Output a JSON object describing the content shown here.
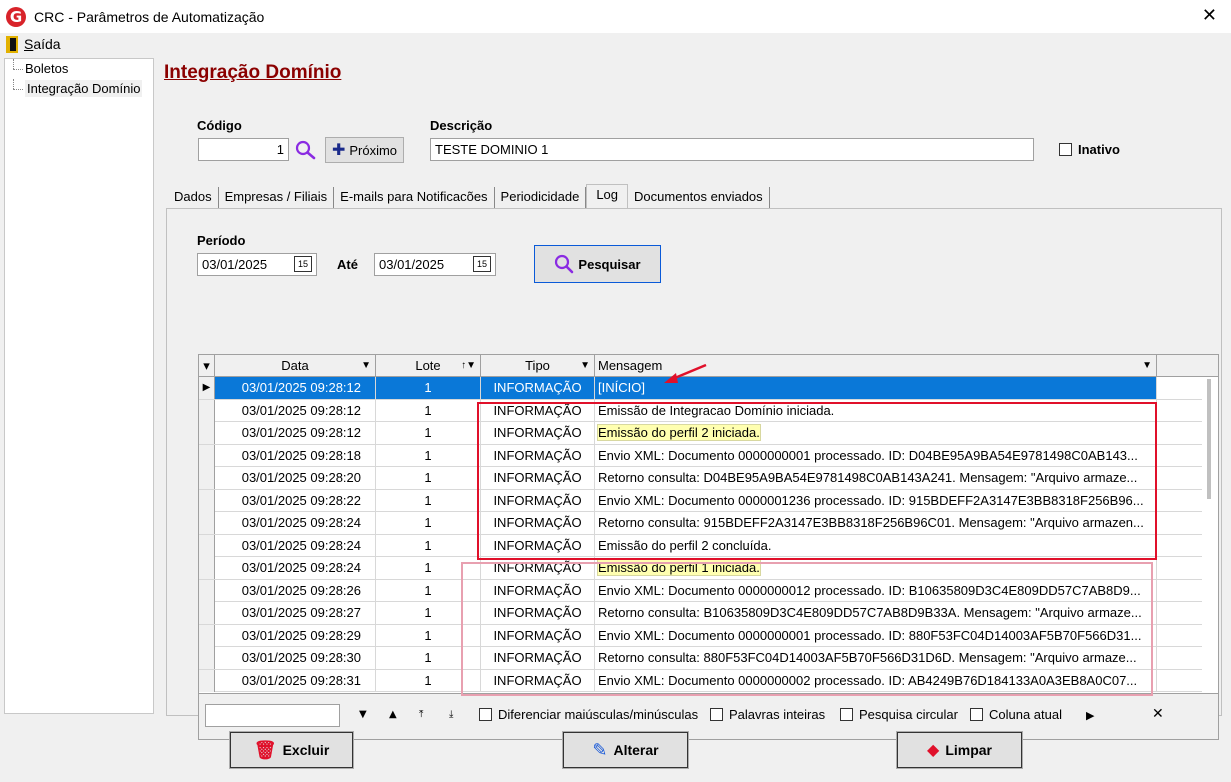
{
  "window": {
    "title": "CRC - Parâmetros de Automatização",
    "close_glyph": "✕",
    "logo_letter": "G"
  },
  "menu": {
    "saida_prefix": "S",
    "saida_rest": "aída"
  },
  "tree": {
    "items": [
      "Boletos",
      "Integração Domínio"
    ]
  },
  "page_title": "Integração Domínio",
  "form": {
    "codigo_label": "Código",
    "codigo_value": "1",
    "proximo_label": "Próximo",
    "descricao_label": "Descrição",
    "descricao_value": "TESTE DOMINIO 1",
    "inativo_label": "Inativo"
  },
  "tabs": [
    "Dados",
    "Empresas / Filiais",
    "E-mails para Notificacões",
    "Periodicidade",
    "Log",
    "Documentos enviados"
  ],
  "log": {
    "periodo_label": "Período",
    "date_from": "03/01/2025",
    "ate_label": "Até",
    "date_to": "03/01/2025",
    "pesquisar_label": "Pesquisar"
  },
  "grid": {
    "columns": [
      "Data",
      "Lote",
      "Tipo",
      "Mensagem"
    ],
    "rows": [
      {
        "data": "03/01/2025 09:28:12",
        "lote": "1",
        "tipo": "INFORMAÇÃO",
        "msg": "[INÍCIO]"
      },
      {
        "data": "03/01/2025 09:28:12",
        "lote": "1",
        "tipo": "INFORMAÇÃO",
        "msg": "Emissão de Integracao Domínio iniciada."
      },
      {
        "data": "03/01/2025 09:28:12",
        "lote": "1",
        "tipo": "INFORMAÇÃO",
        "msg": "Emissão do perfil 2 iniciada."
      },
      {
        "data": "03/01/2025 09:28:18",
        "lote": "1",
        "tipo": "INFORMAÇÃO",
        "msg": "Envio XML: Documento 0000000001 processado. ID: D04BE95A9BA54E9781498C0AB143..."
      },
      {
        "data": "03/01/2025 09:28:20",
        "lote": "1",
        "tipo": "INFORMAÇÃO",
        "msg": "Retorno consulta: D04BE95A9BA54E9781498C0AB143A241. Mensagem: \"Arquivo armaze..."
      },
      {
        "data": "03/01/2025 09:28:22",
        "lote": "1",
        "tipo": "INFORMAÇÃO",
        "msg": "Envio XML: Documento 0000001236 processado. ID: 915BDEFF2A3147E3BB8318F256B96..."
      },
      {
        "data": "03/01/2025 09:28:24",
        "lote": "1",
        "tipo": "INFORMAÇÃO",
        "msg": "Retorno consulta: 915BDEFF2A3147E3BB8318F256B96C01. Mensagem: \"Arquivo armazen..."
      },
      {
        "data": "03/01/2025 09:28:24",
        "lote": "1",
        "tipo": "INFORMAÇÃO",
        "msg": "Emissão do perfil 2 concluída."
      },
      {
        "data": "03/01/2025 09:28:24",
        "lote": "1",
        "tipo": "INFORMAÇÃO",
        "msg": "Emissão do perfil 1 iniciada."
      },
      {
        "data": "03/01/2025 09:28:26",
        "lote": "1",
        "tipo": "INFORMAÇÃO",
        "msg": "Envio XML: Documento 0000000012 processado. ID: B10635809D3C4E809DD57C7AB8D9..."
      },
      {
        "data": "03/01/2025 09:28:27",
        "lote": "1",
        "tipo": "INFORMAÇÃO",
        "msg": "Retorno consulta: B10635809D3C4E809DD57C7AB8D9B33A. Mensagem: \"Arquivo armaze..."
      },
      {
        "data": "03/01/2025 09:28:29",
        "lote": "1",
        "tipo": "INFORMAÇÃO",
        "msg": "Envio XML: Documento 0000000001 processado. ID: 880F53FC04D14003AF5B70F566D31..."
      },
      {
        "data": "03/01/2025 09:28:30",
        "lote": "1",
        "tipo": "INFORMAÇÃO",
        "msg": "Retorno consulta: 880F53FC04D14003AF5B70F566D31D6D. Mensagem: \"Arquivo armaze..."
      },
      {
        "data": "03/01/2025 09:28:31",
        "lote": "1",
        "tipo": "INFORMAÇÃO",
        "msg": "Envio XML: Documento 0000000002 processado. ID: AB4249B76D184133A0A3EB8A0C07..."
      }
    ]
  },
  "findbar": {
    "diferenciar": "Diferenciar maiúsculas/minúsculas",
    "palavras": "Palavras inteiras",
    "circular": "Pesquisa circular",
    "coluna": "Coluna atual"
  },
  "buttons": {
    "excluir": "Excluir",
    "alterar": "Alterar",
    "limpar": "Limpar"
  },
  "colors": {
    "title_red": "#8b0000",
    "selection_blue": "#0a78d8",
    "annotation_red": "#e0102a",
    "highlight_yellow": "#ffffb0"
  }
}
